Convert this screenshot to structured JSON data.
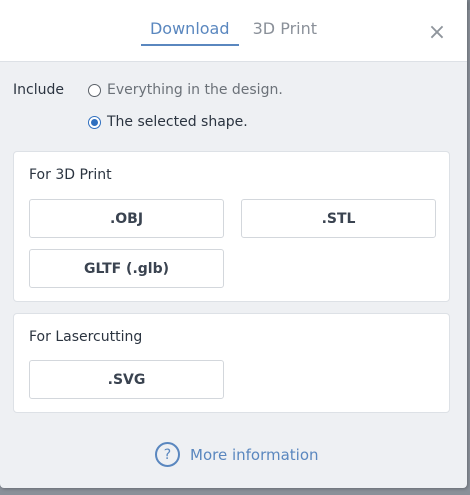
{
  "tabs": [
    {
      "label": "Download",
      "active": true
    },
    {
      "label": "3D Print",
      "active": false
    }
  ],
  "close_icon": "×",
  "include": {
    "label": "Include",
    "options": [
      {
        "label": "Everything in the design.",
        "selected": false
      },
      {
        "label": "The selected shape.",
        "selected": true
      }
    ]
  },
  "print_section": {
    "title": "For 3D Print",
    "buttons": [
      ".OBJ",
      ".STL",
      "GLTF (.glb)"
    ]
  },
  "laser_section": {
    "title": "For Lasercutting",
    "buttons": [
      ".SVG"
    ]
  },
  "more_info": {
    "icon": "?",
    "label": "More information"
  },
  "colors": {
    "accent": "#5a87bf",
    "radio": "#2f6fbf",
    "text": "#2b3440",
    "muted": "#8a9099"
  }
}
